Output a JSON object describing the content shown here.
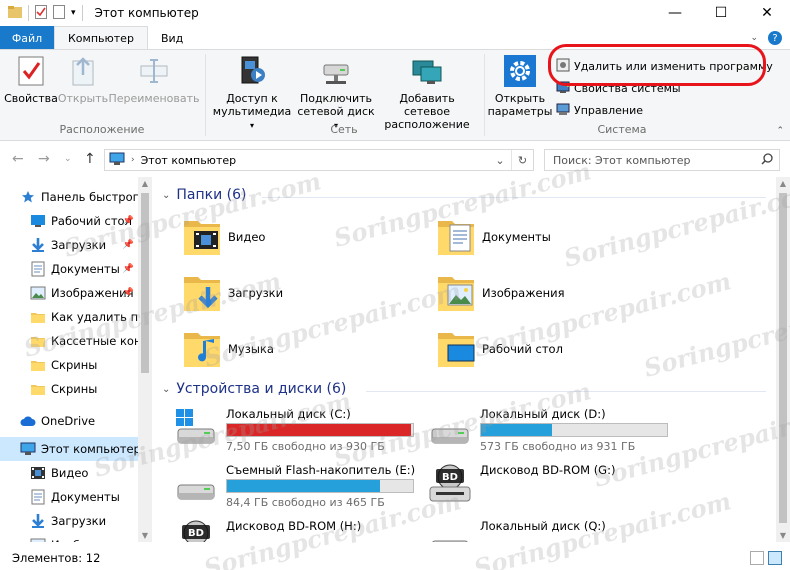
{
  "window": {
    "title": "Этот компьютер",
    "minimize": "—",
    "maximize": "☐",
    "close": "✕"
  },
  "ribbon_tabs": {
    "file": "Файл",
    "computer": "Компьютер",
    "view": "Вид"
  },
  "ribbon": {
    "location": {
      "label": "Расположение",
      "properties": "Свойства",
      "open": "Открыть",
      "rename": "Переименовать"
    },
    "network": {
      "label": "Сеть",
      "media_line1": "Доступ к",
      "media_line2": "мультимедиа",
      "map_line1": "Подключить",
      "map_line2": "сетевой диск",
      "add_line1": "Добавить сетевое",
      "add_line2": "расположение"
    },
    "system": {
      "label": "Система",
      "settings_line1": "Открыть",
      "settings_line2": "параметры",
      "uninstall": "Удалить или изменить программу",
      "sysprops": "Свойства системы",
      "manage": "Управление"
    }
  },
  "address": {
    "path": "Этот компьютер",
    "search_placeholder": "Поиск: Этот компьютер"
  },
  "nav": {
    "quick_access": "Панель быстрого доступа",
    "items": [
      {
        "label": "Рабочий стол",
        "icon": "desktop-icon",
        "pinned": true
      },
      {
        "label": "Загрузки",
        "icon": "download-icon",
        "pinned": true
      },
      {
        "label": "Документы",
        "icon": "document-icon",
        "pinned": true
      },
      {
        "label": "Изображения",
        "icon": "pictures-icon",
        "pinned": true
      },
      {
        "label": "Как удалить программу",
        "icon": "folder-icon",
        "pinned": false
      },
      {
        "label": "Кассетные конденсаторы",
        "icon": "folder-icon",
        "pinned": false
      },
      {
        "label": "Скрины",
        "icon": "folder-icon",
        "pinned": false
      },
      {
        "label": "Скрины",
        "icon": "folder-icon",
        "pinned": false
      }
    ],
    "onedrive": "OneDrive",
    "this_pc": "Этот компьютер",
    "pc_items": [
      {
        "label": "Видео",
        "icon": "video-icon"
      },
      {
        "label": "Документы",
        "icon": "document-icon"
      },
      {
        "label": "Загрузки",
        "icon": "download-icon"
      },
      {
        "label": "Изображения",
        "icon": "pictures-icon"
      }
    ]
  },
  "content": {
    "folders_header": "Папки (6)",
    "folders": [
      {
        "label": "Видео",
        "icon": "video-folder-icon"
      },
      {
        "label": "Документы",
        "icon": "documents-folder-icon"
      },
      {
        "label": "Загрузки",
        "icon": "downloads-folder-icon"
      },
      {
        "label": "Изображения",
        "icon": "pictures-folder-icon"
      },
      {
        "label": "Музыка",
        "icon": "music-folder-icon"
      },
      {
        "label": "Рабочий стол",
        "icon": "desktop-folder-icon"
      }
    ],
    "devices_header": "Устройства и диски (6)",
    "drives": [
      {
        "name": "Локальный диск (C:)",
        "free": "7,50 ГБ свободно из 930 ГБ",
        "used_fraction": 0.99,
        "bar_color": "#da2626",
        "icon": "windows-drive-icon"
      },
      {
        "name": "Локальный диск (D:)",
        "free": "573 ГБ свободно из 931 ГБ",
        "used_fraction": 0.38,
        "bar_color": "#26a0da",
        "icon": "hard-drive-icon"
      },
      {
        "name": "Съемный Flash-накопитель (E:)",
        "free": "84,4 ГБ свободно из 465 ГБ",
        "used_fraction": 0.82,
        "bar_color": "#26a0da",
        "icon": "hard-drive-icon"
      },
      {
        "name": "Дисковод BD-ROM (G:)",
        "icon": "bd-rom-icon"
      },
      {
        "name": "Дисковод BD-ROM (H:)",
        "icon": "bd-rom-icon"
      },
      {
        "name": "Локальный диск (Q:)",
        "icon": "hard-drive-icon"
      }
    ]
  },
  "status": {
    "items": "Элементов: 12"
  },
  "watermark": "Soringpcrepair.com"
}
